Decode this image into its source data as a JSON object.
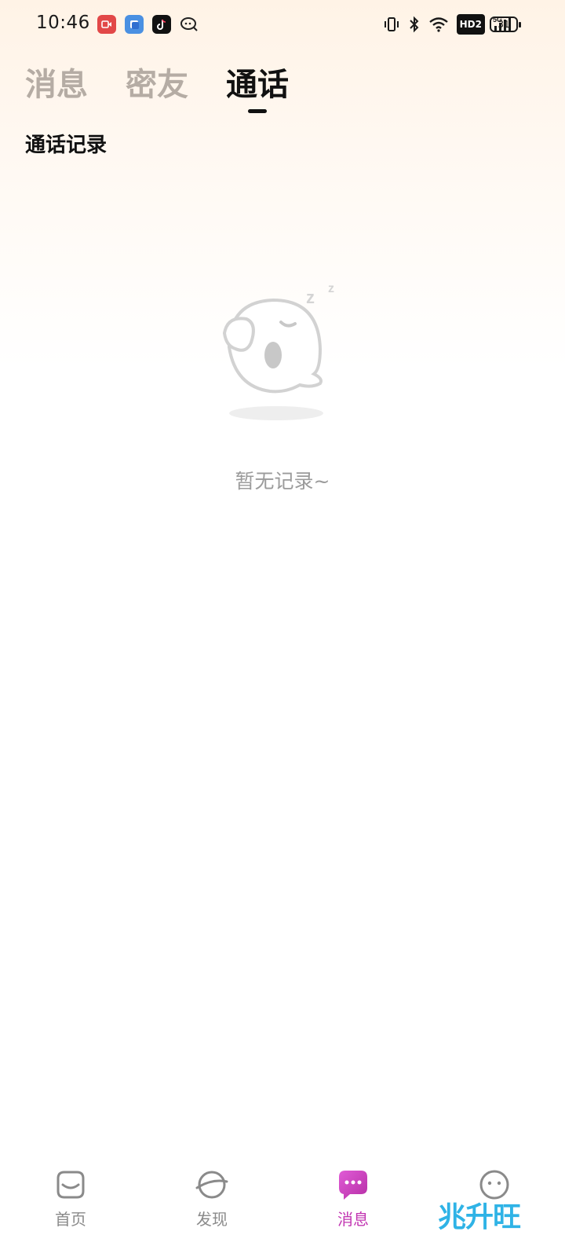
{
  "status_bar": {
    "time": "10:46",
    "notification_icons": [
      "video-app-icon",
      "blue-app-icon",
      "tiktok-icon",
      "chat-app-icon"
    ],
    "system_icons": [
      "vibrate-icon",
      "bluetooth-icon",
      "wifi-icon",
      "hd-icon",
      "5g-signal-icon"
    ],
    "hd_label": "HD2",
    "network_label": "5G",
    "battery": "31"
  },
  "tabs": [
    {
      "label": "消息",
      "active": false
    },
    {
      "label": "密友",
      "active": false
    },
    {
      "label": "通话",
      "active": true
    }
  ],
  "section_title": "通话记录",
  "empty_state": {
    "message": "暂无记录~",
    "illustration": "sleeping-ghost-icon"
  },
  "bottom_nav": [
    {
      "label": "首页",
      "icon": "home-icon",
      "active": false
    },
    {
      "label": "发现",
      "icon": "planet-icon",
      "active": false
    },
    {
      "label": "消息",
      "icon": "message-icon",
      "active": true
    },
    {
      "label": "",
      "icon": "profile-icon",
      "active": false
    }
  ],
  "watermark": "兆升旺",
  "colors": {
    "active_tab": "#111111",
    "inactive_tab": "#b5aca4",
    "nav_active": "#c236b2",
    "empty_text": "#9b9b9b"
  }
}
